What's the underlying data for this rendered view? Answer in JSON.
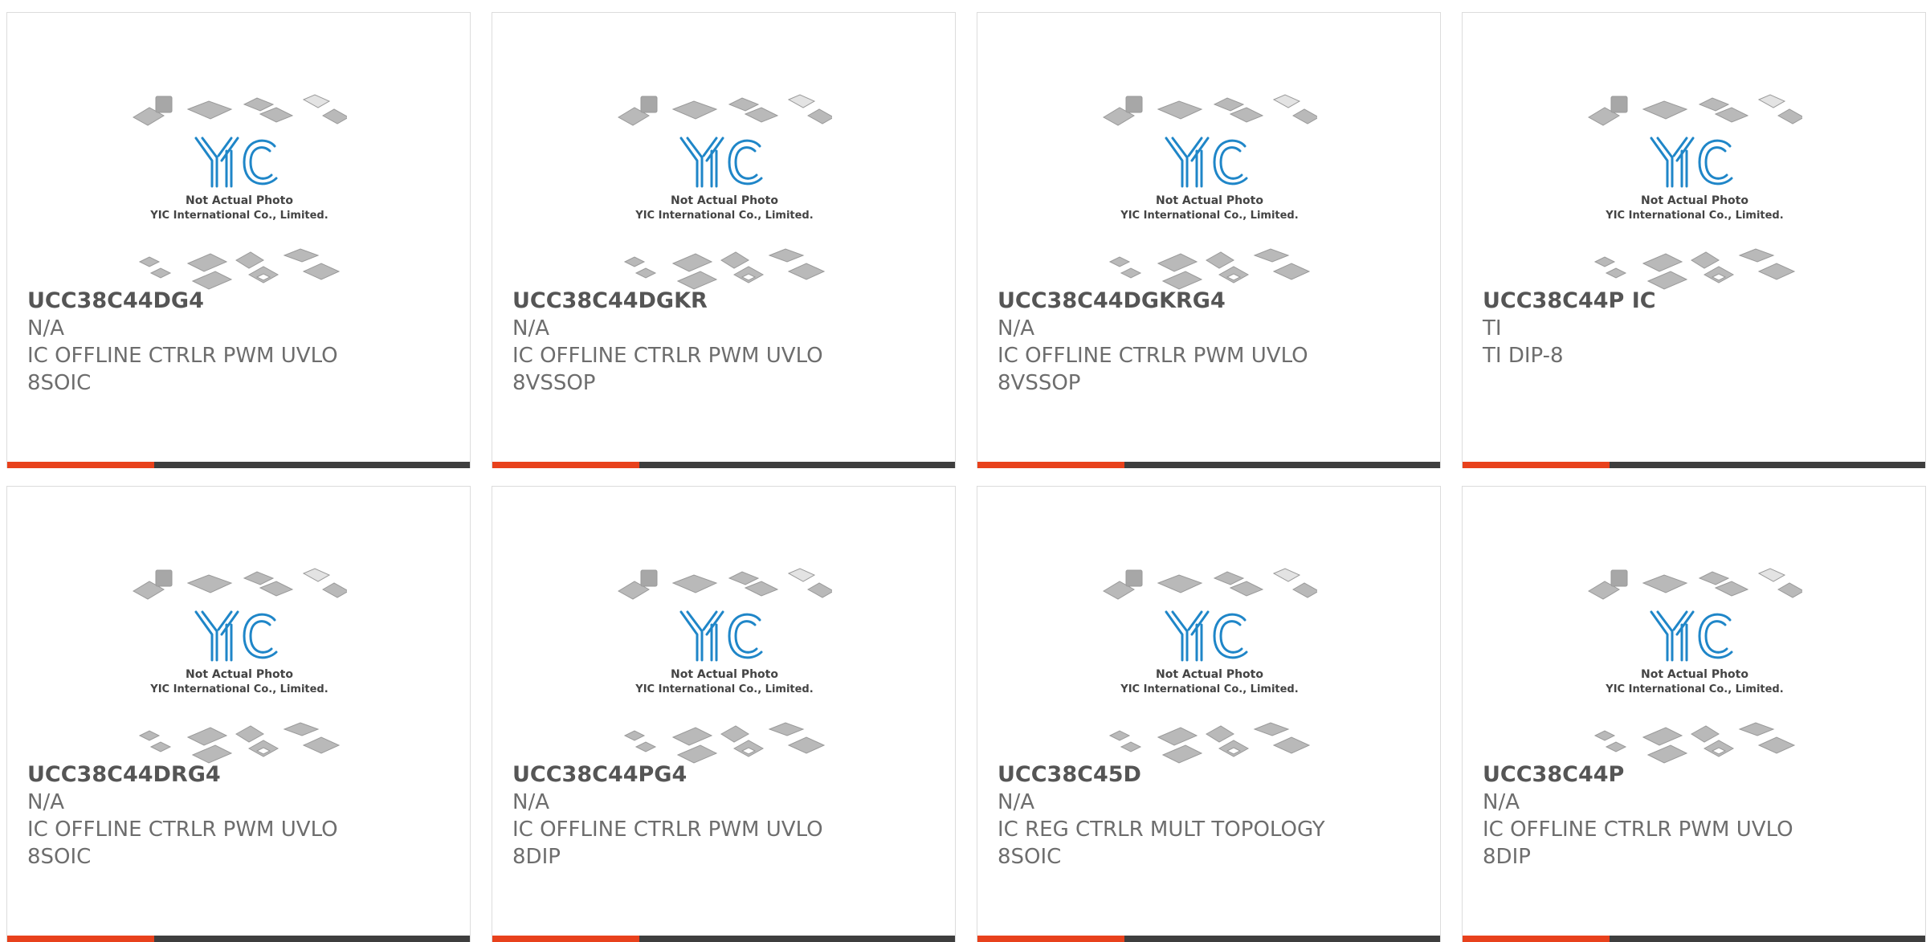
{
  "colors": {
    "accent": "#e8411c",
    "bar": "#3e3e3e",
    "logo": "#1f86c8",
    "chip": "#b5b5b5"
  },
  "photo": {
    "caption_line1": "Not Actual Photo",
    "caption_line2": "YIC International Co., Limited.",
    "logo_text": "YIC"
  },
  "products": [
    {
      "part": "UCC38C44DG4",
      "maker": "N/A",
      "desc_line1": "IC OFFLINE CTRLR PWM UVLO",
      "desc_line2": "8SOIC"
    },
    {
      "part": "UCC38C44DGKR",
      "maker": "N/A",
      "desc_line1": "IC OFFLINE CTRLR PWM UVLO",
      "desc_line2": "8VSSOP"
    },
    {
      "part": "UCC38C44DGKRG4",
      "maker": "N/A",
      "desc_line1": "IC OFFLINE CTRLR PWM UVLO",
      "desc_line2": "8VSSOP"
    },
    {
      "part": "UCC38C44P IC",
      "maker": "TI",
      "desc_line1": "TI DIP-8",
      "desc_line2": ""
    },
    {
      "part": "UCC38C44DRG4",
      "maker": "N/A",
      "desc_line1": "IC OFFLINE CTRLR PWM UVLO",
      "desc_line2": "8SOIC"
    },
    {
      "part": "UCC38C44PG4",
      "maker": "N/A",
      "desc_line1": "IC OFFLINE CTRLR PWM UVLO",
      "desc_line2": "8DIP"
    },
    {
      "part": "UCC38C45D",
      "maker": "N/A",
      "desc_line1": "IC REG CTRLR MULT TOPOLOGY",
      "desc_line2": "8SOIC"
    },
    {
      "part": "UCC38C44P",
      "maker": "N/A",
      "desc_line1": "IC OFFLINE CTRLR PWM UVLO",
      "desc_line2": "8DIP"
    }
  ]
}
